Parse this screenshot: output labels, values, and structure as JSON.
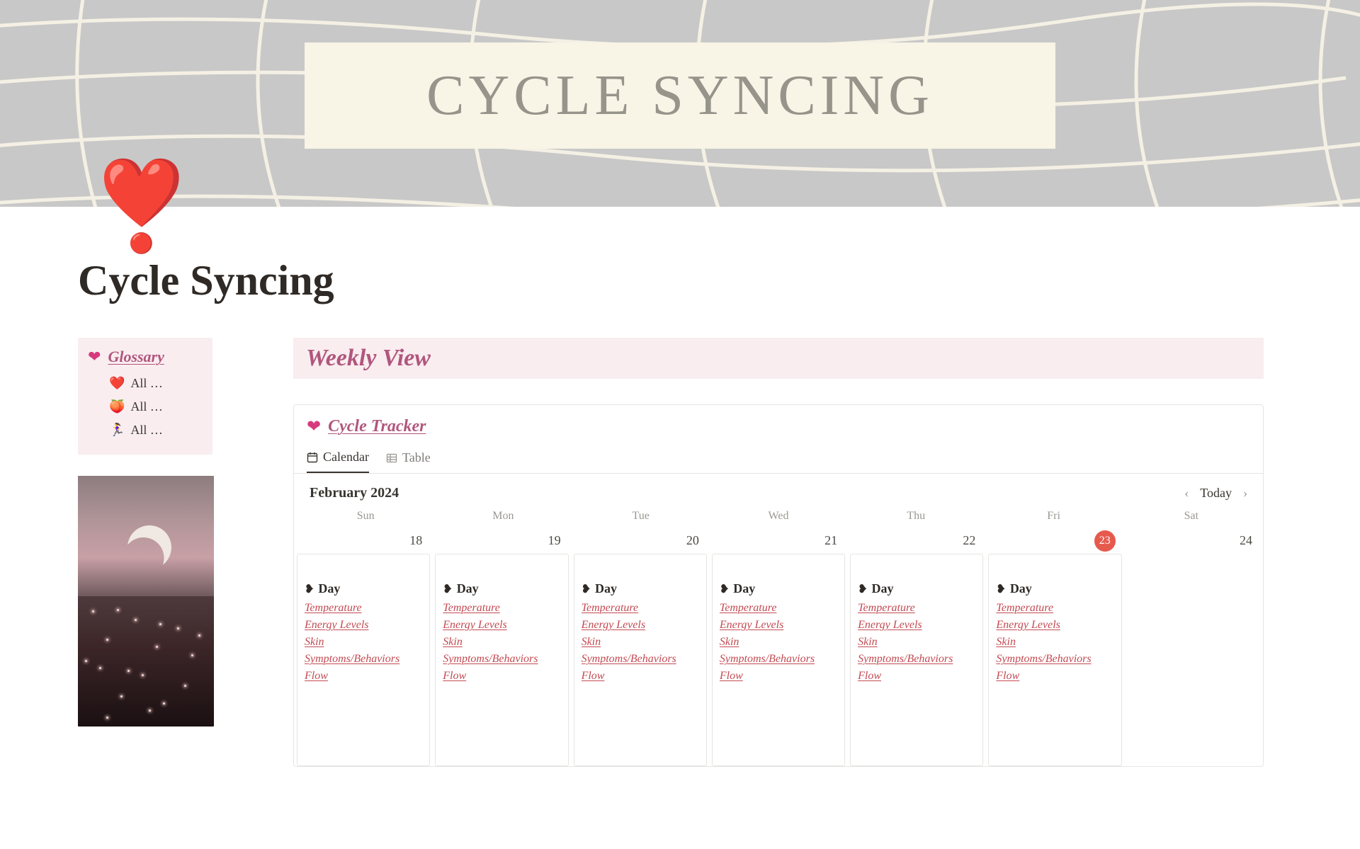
{
  "cover": {
    "title": "CYCLE SYNCING"
  },
  "page": {
    "icon": "❤️",
    "title": "Cycle Syncing"
  },
  "sidebar": {
    "glossary_label": "Glossary",
    "items": [
      {
        "emoji": "❤️",
        "label": "All …"
      },
      {
        "emoji": "🍑",
        "label": "All …"
      },
      {
        "emoji": "🏃‍♀️",
        "label": "All …"
      }
    ]
  },
  "main": {
    "weekly_heading": "Weekly View",
    "tracker_heading": "Cycle Tracker",
    "views": {
      "calendar": "Calendar",
      "table": "Table"
    },
    "calendar": {
      "month": "February 2024",
      "today_label": "Today",
      "dow": [
        "Sun",
        "Mon",
        "Tue",
        "Wed",
        "Thu",
        "Fri",
        "Sat"
      ],
      "dates": [
        "18",
        "19",
        "20",
        "21",
        "22",
        "23",
        "24"
      ],
      "today_index": 5,
      "card_title": "Day",
      "fields": [
        "Temperature",
        "Energy Levels",
        "Skin",
        "Symptoms/Behaviors",
        "Flow"
      ]
    }
  }
}
